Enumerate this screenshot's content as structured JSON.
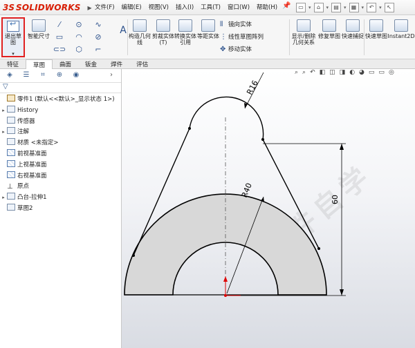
{
  "app": {
    "logo_prefix": "3S",
    "logo_name": "SOLIDWORKS"
  },
  "menu": [
    "文件(F)",
    "编辑(E)",
    "视图(V)",
    "插入(I)",
    "工具(T)",
    "窗口(W)",
    "帮助(H)"
  ],
  "ribbon": {
    "exit_sketch": "退出草图",
    "smart_dim": "智能尺寸",
    "construction_geom": "构造几何线",
    "trim": "剪裁实体(T)",
    "convert": "转换实体引用",
    "offset": "等距实体",
    "mirror": "镜向实体",
    "linear_pattern": "线性草图阵列",
    "move": "移动实体",
    "display_relations": "显示/删除几何关系",
    "repair": "修复草图",
    "quick_snap": "快速捕捉",
    "rapid_sketch": "快速草图",
    "instant2d": "Instant2D"
  },
  "tabs": [
    "特征",
    "草图",
    "曲面",
    "钣金",
    "焊件",
    "评估"
  ],
  "active_tab": "草图",
  "tree": [
    {
      "label": "零件1 (默认<<默认>_显示状态 1>)",
      "expand": "",
      "type": "root"
    },
    {
      "label": "History",
      "expand": "▸",
      "type": "folder"
    },
    {
      "label": "传感器",
      "expand": "",
      "type": "folder"
    },
    {
      "label": "注解",
      "expand": "▸",
      "type": "annot"
    },
    {
      "label": "材质 <未指定>",
      "expand": "",
      "type": "material"
    },
    {
      "label": "前视基准面",
      "expand": "",
      "type": "plane"
    },
    {
      "label": "上视基准面",
      "expand": "",
      "type": "plane"
    },
    {
      "label": "右视基准面",
      "expand": "",
      "type": "plane"
    },
    {
      "label": "原点",
      "expand": "",
      "type": "origin"
    },
    {
      "label": "凸台-拉伸1",
      "expand": "▸",
      "type": "feature"
    },
    {
      "label": "草图2",
      "expand": "",
      "type": "sketch"
    }
  ],
  "dimensions": {
    "r_small": "R16",
    "r_large": "R40",
    "height": "60"
  },
  "watermark": "软件自学网"
}
